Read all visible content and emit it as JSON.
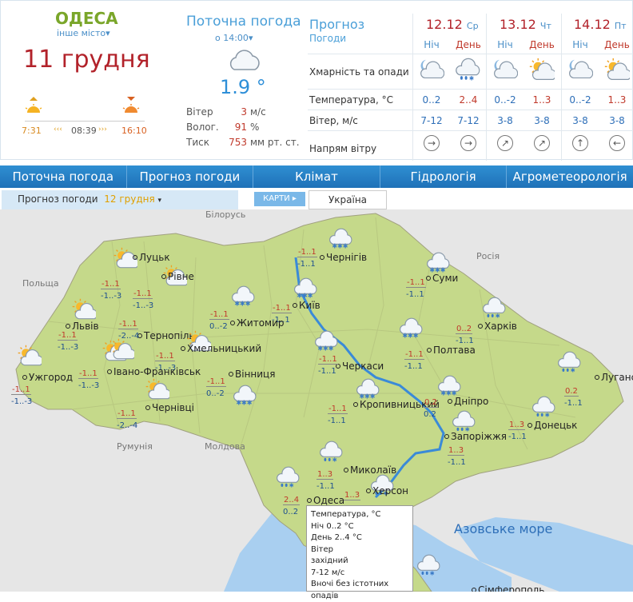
{
  "header": {
    "city": "ОДЕСА",
    "other_city": "інше місто",
    "date": "11 грудня",
    "sunrise": "7:31",
    "daylength": "08:39",
    "sunset": "16:10"
  },
  "current": {
    "title": "Поточна погода",
    "time": "о 14:00",
    "temp": "1.9 °",
    "wind_label": "Вітер",
    "wind_value": "3",
    "wind_unit": "м/с",
    "hum_label": "Волог.",
    "hum_value": "91",
    "hum_unit": "%",
    "press_label": "Тиск",
    "press_value": "753",
    "press_unit": "мм рт. ст."
  },
  "forecast": {
    "title": "Прогноз",
    "subtitle": "Погоди",
    "rows": [
      "Хмарність та опади",
      "Температура, °C",
      "Вітер, м/с",
      "Напрям вітру"
    ],
    "days": [
      {
        "date": "12.12",
        "dow": "Ср"
      },
      {
        "date": "13.12",
        "dow": "Чт"
      },
      {
        "date": "14.12",
        "dow": "Пт"
      }
    ],
    "cols": [
      {
        "label": "Ніч",
        "temp": "0..2",
        "wind": "7-12",
        "dir": "→",
        "icon": "moon-cloud-icon"
      },
      {
        "label": "День",
        "temp": "2..4",
        "wind": "7-12",
        "dir": "→",
        "icon": "cloud-rain-snow-icon"
      },
      {
        "label": "Ніч",
        "temp": "0..-2",
        "wind": "3-8",
        "dir": "↗",
        "icon": "moon-cloud-icon"
      },
      {
        "label": "День",
        "temp": "1..3",
        "wind": "3-8",
        "dir": "↗",
        "icon": "sun-cloud-icon"
      },
      {
        "label": "Ніч",
        "temp": "0..-2",
        "wind": "3-8",
        "dir": "↑",
        "icon": "moon-cloud-icon"
      },
      {
        "label": "День",
        "temp": "1..3",
        "wind": "3-8",
        "dir": "←",
        "icon": "sun-cloud-icon"
      }
    ]
  },
  "nav": [
    "Поточна погода",
    "Прогноз погоди",
    "Клімат",
    "Гідрологія",
    "Агрометеорологія"
  ],
  "subnav": {
    "label": "Прогноз погоди",
    "date": "12 грудня",
    "maps": "КАРТИ",
    "region": "Україна"
  },
  "map": {
    "countries": [
      "Білорусь",
      "Польща",
      "Росія",
      "Румунія",
      "Молдова"
    ],
    "sea": "Азовське море",
    "cities": [
      {
        "name": "Чернігів",
        "night": "-1..1",
        "day": "-1..1"
      },
      {
        "name": "Київ",
        "night": "-1..1",
        "day": "-1..1"
      },
      {
        "name": "Суми",
        "night": "-1..1",
        "day": "-1..1"
      },
      {
        "name": "Луцьк",
        "night": "-1..1",
        "day": "-1..-3"
      },
      {
        "name": "Рівне",
        "night": "-1..1",
        "day": "-1..-3"
      },
      {
        "name": "Житомир",
        "night": "-1..1",
        "day": "0..-2"
      },
      {
        "name": "Харків",
        "night": "0..2",
        "day": "-1..1"
      },
      {
        "name": "Львів",
        "night": "-1..1",
        "day": "-1..-3"
      },
      {
        "name": "Тернопіль",
        "night": "-1..1",
        "day": "-2..-4"
      },
      {
        "name": "Полтава",
        "night": "-1..1",
        "day": "-1..1"
      },
      {
        "name": "Хмельницький",
        "night": "-1..1",
        "day": "-1..-3"
      },
      {
        "name": "Черкаси",
        "night": "-1..1",
        "day": "-1..1"
      },
      {
        "name": "Ужгород",
        "night": "-1..1",
        "day": "-1..-3"
      },
      {
        "name": "Івано-Франківськ",
        "night": "-1..1",
        "day": "-1..-3"
      },
      {
        "name": "Вінниця",
        "night": "-1..1",
        "day": "0..-2"
      },
      {
        "name": "Луганськ",
        "night": "0.2",
        "day": "-1..1"
      },
      {
        "name": "Чернівці",
        "night": "-1..1",
        "day": "-2..-4"
      },
      {
        "name": "Кропивницький",
        "night": "-1..1",
        "day": "-1..1"
      },
      {
        "name": "Дніпро",
        "night": "0.2",
        "day": "0.2"
      },
      {
        "name": "Донецьк",
        "night": "1..3",
        "day": "-1..1"
      },
      {
        "name": "Запоріжжя",
        "night": "1..3",
        "day": "-1..1"
      },
      {
        "name": "Миколаїв",
        "night": "1..3",
        "day": "-1..1"
      },
      {
        "name": "Одеса",
        "night": "2..4",
        "day": "0..2"
      },
      {
        "name": "Херсон",
        "night": "1..3",
        "day": ""
      },
      {
        "name": "Сімферополь",
        "night": "",
        "day": ""
      }
    ]
  },
  "tooltip": {
    "lines": [
      "Температура, °C",
      "Ніч 0..2 °C",
      "День 2..4 °C",
      "Вітер",
      "західний",
      "7-12 м/с",
      "Вночі без істотних опадів"
    ]
  },
  "colors": {
    "accent": "#2f8fd2",
    "date": "#b2222a",
    "city": "#7aa62a",
    "map_land": "#c5d98a"
  }
}
